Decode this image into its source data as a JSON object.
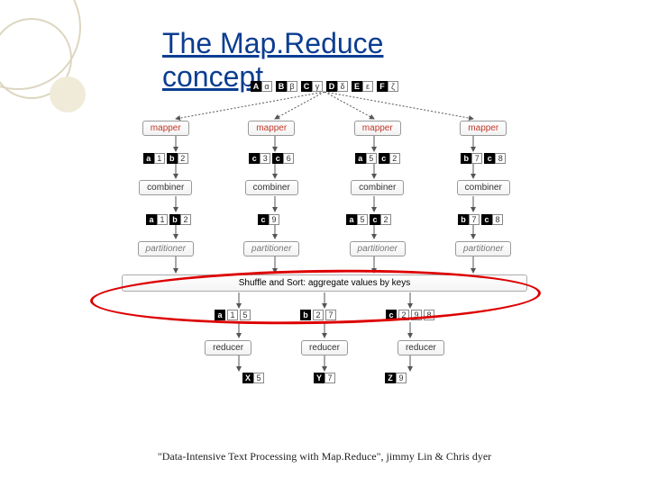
{
  "title": "The Map.Reduce concept",
  "input_pairs": [
    {
      "k": "A",
      "v": "α"
    },
    {
      "k": "B",
      "v": "β"
    },
    {
      "k": "C",
      "v": "γ"
    },
    {
      "k": "D",
      "v": "δ"
    },
    {
      "k": "E",
      "v": "ε"
    },
    {
      "k": "F",
      "v": "ζ"
    }
  ],
  "mapper_label": "mapper",
  "combiner_label": "combiner",
  "partitioner_label": "partitioner",
  "reducer_label": "reducer",
  "mapper_outputs": [
    [
      {
        "k": "a",
        "v": "1"
      },
      {
        "k": "b",
        "v": "2"
      }
    ],
    [
      {
        "k": "c",
        "v": "3"
      },
      {
        "k": "c",
        "v": "6"
      }
    ],
    [
      {
        "k": "a",
        "v": "5"
      },
      {
        "k": "c",
        "v": "2"
      }
    ],
    [
      {
        "k": "b",
        "v": "7"
      },
      {
        "k": "c",
        "v": "8"
      }
    ]
  ],
  "combiner_outputs": [
    [
      {
        "k": "a",
        "v": "1"
      },
      {
        "k": "b",
        "v": "2"
      }
    ],
    [
      {
        "k": "c",
        "v": "9"
      }
    ],
    [
      {
        "k": "a",
        "v": "5"
      },
      {
        "k": "c",
        "v": "2"
      }
    ],
    [
      {
        "k": "b",
        "v": "7"
      },
      {
        "k": "c",
        "v": "8"
      }
    ]
  ],
  "shuffle_label": "Shuffle and Sort: aggregate values by keys",
  "shuffle_outputs": [
    {
      "k": "a",
      "vs": [
        "1",
        "5"
      ]
    },
    {
      "k": "b",
      "vs": [
        "2",
        "7"
      ]
    },
    {
      "k": "c",
      "vs": [
        "2",
        "9",
        "8"
      ]
    }
  ],
  "reducer_outputs": [
    {
      "k": "X",
      "v": "5"
    },
    {
      "k": "Y",
      "v": "7"
    },
    {
      "k": "Z",
      "v": "9"
    }
  ],
  "citation": "\"Data-Intensive Text Processing with Map.Reduce\", jimmy Lin & Chris dyer"
}
